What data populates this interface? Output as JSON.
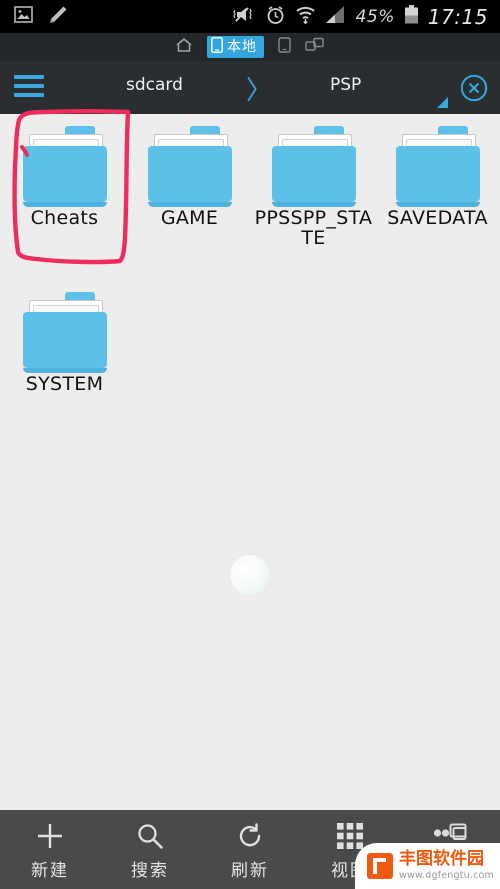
{
  "colors": {
    "folder_blue": "#5cc0e8",
    "accent_blue": "#33a7dd",
    "statusbar_bg": "#000000",
    "tabbar_bg": "#25282b",
    "pathbar_bg": "#2b2e31",
    "page_bg": "#ededed",
    "toolbar_bg": "#4a4a4a",
    "annotation_red": "#ee2d5e",
    "watermark_orange": "#f05a10"
  },
  "statusbar": {
    "left_icons": [
      {
        "name": "gallery-icon"
      },
      {
        "name": "pencil-icon"
      }
    ],
    "right_icons": [
      {
        "name": "vibrate-mute-icon"
      },
      {
        "name": "alarm-clock-icon"
      },
      {
        "name": "wifi-icon"
      },
      {
        "name": "cellular-signal-icon"
      }
    ],
    "battery_percent": "45%",
    "battery_icon": "battery-icon",
    "time": "17:15"
  },
  "tabbar": {
    "items": [
      {
        "name": "home-icon",
        "label": ""
      },
      {
        "name": "tab-local",
        "label": "本地",
        "selected": true
      },
      {
        "name": "device-icon",
        "label": ""
      },
      {
        "name": "network-icon",
        "label": ""
      }
    ]
  },
  "pathbar": {
    "menu_icon": "hamburger-menu-icon",
    "crumbs": [
      {
        "label": "sdcard"
      },
      {
        "label": "PSP"
      }
    ],
    "separator": "〉",
    "resize_handle": "resize-triangle-icon",
    "close_icon": "close-circle-icon"
  },
  "grid": {
    "items": [
      {
        "label": "Cheats",
        "type": "folder",
        "annotated": true
      },
      {
        "label": "GAME",
        "type": "folder",
        "annotated": false
      },
      {
        "label": "PPSSPP_STATE",
        "type": "folder",
        "annotated": false
      },
      {
        "label": "SAVEDATA",
        "type": "folder",
        "annotated": false
      },
      {
        "label": "SYSTEM",
        "type": "folder",
        "annotated": false
      }
    ],
    "loading_indicator": "loading-ripple"
  },
  "toolbar": {
    "items": [
      {
        "label": "新建",
        "icon": "plus-icon"
      },
      {
        "label": "搜索",
        "icon": "search-icon"
      },
      {
        "label": "刷新",
        "icon": "refresh-icon"
      },
      {
        "label": "视图",
        "icon": "grid-view-icon"
      },
      {
        "label": "",
        "icon": "more-windows-icon"
      }
    ]
  },
  "watermark": {
    "brand": "丰图软件园",
    "url": "www.dgfengtu.com",
    "logo": "fengtu-logo-icon"
  }
}
